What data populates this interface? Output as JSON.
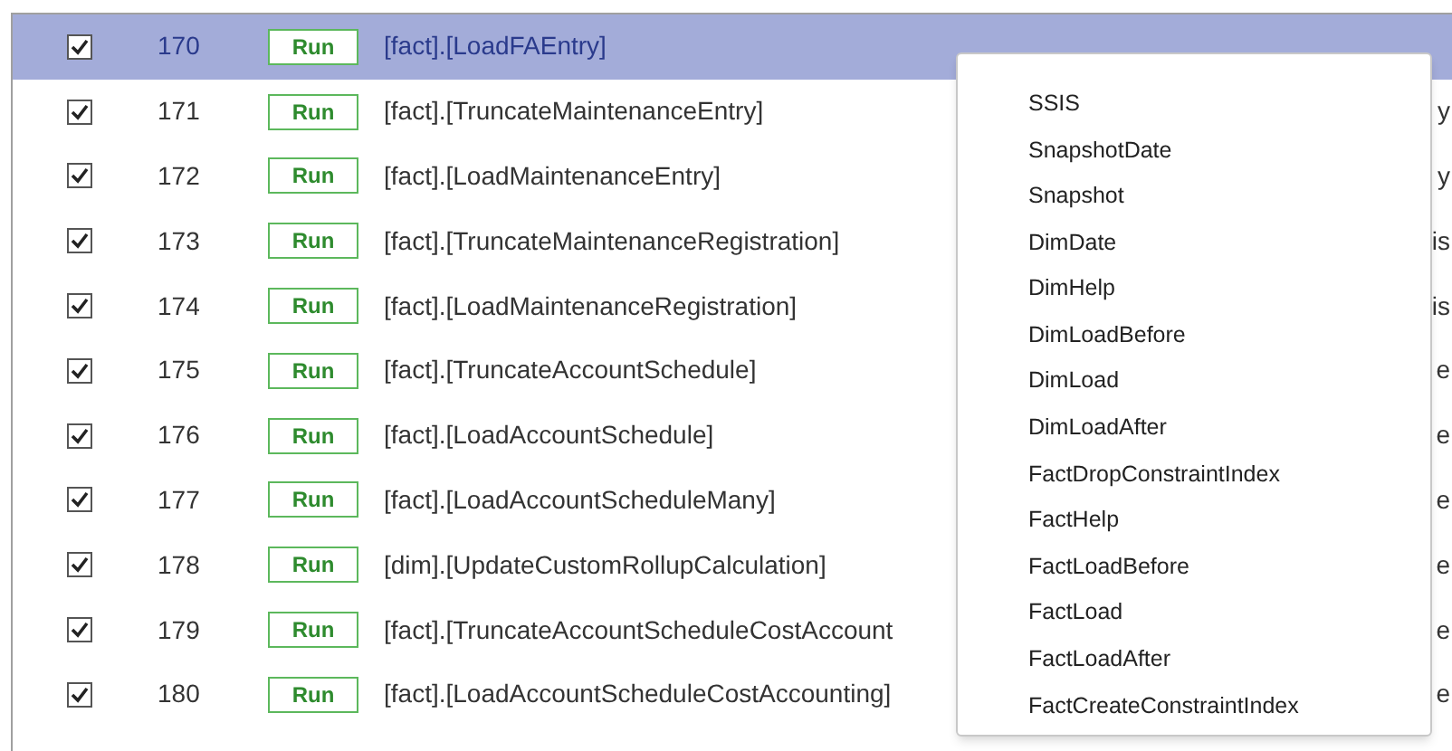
{
  "rows": [
    {
      "checked": true,
      "number": "170",
      "run": "Run",
      "name": "[fact].[LoadFAEntry]",
      "selected": true
    },
    {
      "checked": true,
      "number": "171",
      "run": "Run",
      "name": "[fact].[TruncateMaintenanceEntry]",
      "selected": false,
      "column_3": "y"
    },
    {
      "checked": true,
      "number": "172",
      "run": "Run",
      "name": "[fact].[LoadMaintenanceEntry]",
      "selected": false,
      "column_3": "y"
    },
    {
      "checked": true,
      "number": "173",
      "run": "Run",
      "name": "[fact].[TruncateMaintenanceRegistration]",
      "selected": false,
      "column_3": "is"
    },
    {
      "checked": true,
      "number": "174",
      "run": "Run",
      "name": "[fact].[LoadMaintenanceRegistration]",
      "selected": false,
      "column_3": "is"
    },
    {
      "checked": true,
      "number": "175",
      "run": "Run",
      "name": "[fact].[TruncateAccountSchedule]",
      "selected": false,
      "column_3": "e"
    },
    {
      "checked": true,
      "number": "176",
      "run": "Run",
      "name": "[fact].[LoadAccountSchedule]",
      "selected": false,
      "column_3": "e"
    },
    {
      "checked": true,
      "number": "177",
      "run": "Run",
      "name": "[fact].[LoadAccountScheduleMany]",
      "selected": false,
      "column_3": "e"
    },
    {
      "checked": true,
      "number": "178",
      "run": "Run",
      "name": "[dim].[UpdateCustomRollupCalculation]",
      "selected": false,
      "column_3": "e"
    },
    {
      "checked": true,
      "number": "179",
      "run": "Run",
      "name": "[fact].[TruncateAccountScheduleCostAccount",
      "selected": false,
      "column_3": "e"
    },
    {
      "checked": true,
      "number": "180",
      "run": "Run",
      "name": "[fact].[LoadAccountScheduleCostAccounting]",
      "selected": false,
      "column_3": "e"
    }
  ],
  "menu": {
    "items": [
      "SSIS",
      "SnapshotDate",
      "Snapshot",
      "DimDate",
      "DimHelp",
      "DimLoadBefore",
      "DimLoad",
      "DimLoadAfter",
      "FactDropConstraintIndex",
      "FactHelp",
      "FactLoadBefore",
      "FactLoad",
      "FactLoadAfter",
      "FactCreateConstraintIndex"
    ]
  }
}
